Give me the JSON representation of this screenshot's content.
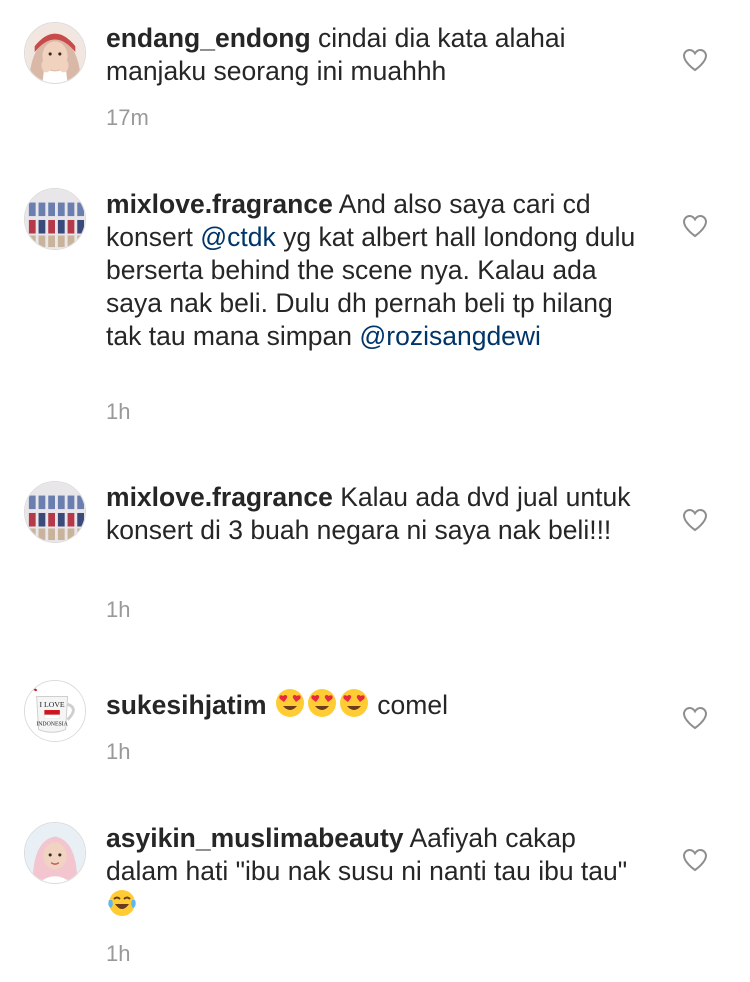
{
  "comments": [
    {
      "username": "endang_endong",
      "text": "cindai dia kata alahai manjaku seorang ini muahhh",
      "time": "17m"
    },
    {
      "username": "mixlove.fragrance",
      "text_before": "And also saya cari cd konsert ",
      "mention1": "@ctdk",
      "text_middle": "  yg kat albert hall londong dulu berserta behind the scene nya. Kalau ada saya nak beli. Dulu dh pernah beli tp hilang tak tau mana simpan",
      "mention2": "@rozisangdewi",
      "time": "1h"
    },
    {
      "username": "mixlove.fragrance",
      "text": "Kalau ada dvd jual untuk konsert di 3 buah negara ni saya nak beli!!!",
      "time": "1h"
    },
    {
      "username": "sukesihjatim",
      "text_after": " comel",
      "time": "1h",
      "mug_line1": "I LOVE",
      "mug_line2": "INDONESIA"
    },
    {
      "username": "asyikin_muslimabeauty",
      "text": "Aafiyah cakap dalam hati \"ibu nak susu ni nanti tau ibu tau\"",
      "time": "1h"
    }
  ],
  "icons": {
    "like": "heart-outline-icon",
    "emoji_love": "heart-eyes-emoji",
    "emoji_laugh": "tears-of-joy-emoji"
  },
  "colors": {
    "text": "#262626",
    "mention": "#003569",
    "timestamp": "#999999",
    "heart_stroke": "#8e8e8e"
  }
}
